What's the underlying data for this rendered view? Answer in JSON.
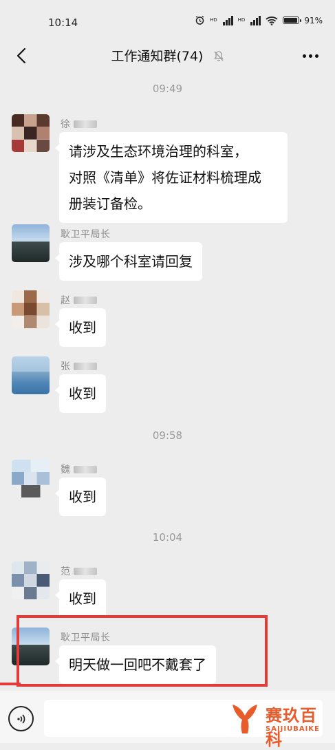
{
  "status": {
    "time": "10:14",
    "battery": "91"
  },
  "header": {
    "title": "工作通知群(74)"
  },
  "timestamps": [
    "09:49",
    "09:58",
    "10:04"
  ],
  "messages": [
    {
      "sender": "徐",
      "text": "请涉及生态环境治理的科室，对照《清单》将佐证材料梳理成册装订备检。",
      "lines": [
        "请涉及生态环境治理的科室，",
        "对照《清单》将佐证材料梳理成",
        "册装订备检。"
      ]
    },
    {
      "sender": "耿卫平局长",
      "text": "涉及哪个科室请回复"
    },
    {
      "sender": "赵",
      "text": "收到"
    },
    {
      "sender": "张",
      "text": "收到"
    },
    {
      "sender": "魏",
      "text": "收到"
    },
    {
      "sender": "范",
      "text": "收到"
    },
    {
      "sender": "耿卫平局长",
      "text": "明天做一回吧不戴套了"
    }
  ],
  "watermark": {
    "name": "赛玖百科",
    "sub": "SAIJIUBAIKE"
  },
  "colors": {
    "background": "#ededed",
    "bubble": "#ffffff",
    "highlight": "#e33a3a",
    "watermark": "#e85c2c"
  },
  "icons": {
    "back": "chevron-left-icon",
    "mute": "bell-off-icon",
    "more": "more-dots-icon",
    "voice": "voice-icon"
  }
}
